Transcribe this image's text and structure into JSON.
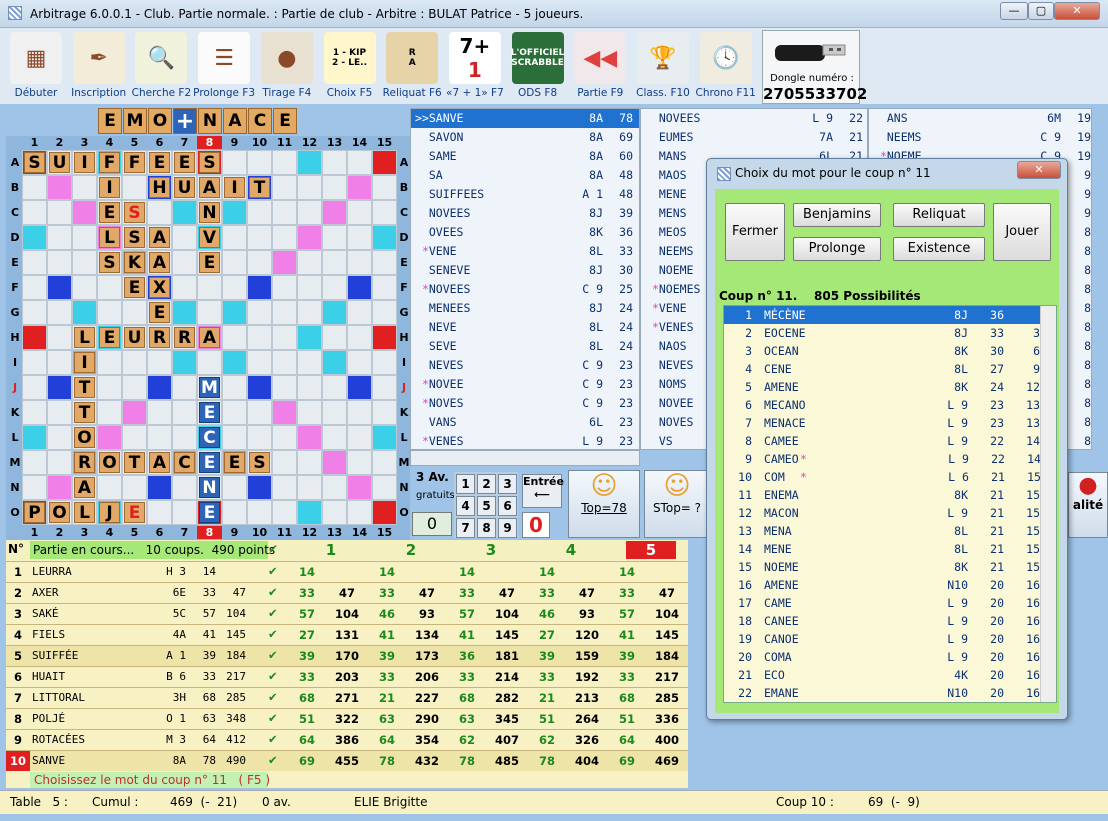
{
  "window": {
    "title": "Arbitrage 6.0.0.1 - Club. Partie normale. : Partie de club - Arbitre : BULAT Patrice - 5 joueurs."
  },
  "toolbar": [
    {
      "label": "Débuter",
      "icon": "grid-icon"
    },
    {
      "label": "Inscription",
      "icon": "quill-icon"
    },
    {
      "label": "Cherche F2",
      "icon": "magnifier-icon"
    },
    {
      "label": "Prolonge F3",
      "icon": "list-icon"
    },
    {
      "label": "Tirage F4",
      "icon": "bag-icon"
    },
    {
      "label": "Choix F5",
      "icon": "choice-icon",
      "text1": "1 - KIP",
      "text2": "2 - LE.."
    },
    {
      "label": "Reliquat F6",
      "icon": "tiles-icon",
      "text1": "R",
      "text2": "A"
    },
    {
      "label": "«7 + 1» F7",
      "icon": "seven-plus-one-icon",
      "text1": "7+",
      "text2": "1"
    },
    {
      "label": "ODS F8",
      "icon": "dictionary-icon",
      "text1": "L'OFFICIEL",
      "text2": "SCRABBLE"
    },
    {
      "label": "Partie F9",
      "icon": "rewind-icon"
    },
    {
      "label": "Class. F10",
      "icon": "trophy-icon"
    },
    {
      "label": "Chrono F11",
      "icon": "clock-icon"
    }
  ],
  "dongle": {
    "label": "Dongle numéro :",
    "number": "2705533702"
  },
  "rack": {
    "left": [
      "E",
      "M",
      "O"
    ],
    "right": [
      "N",
      "A",
      "C",
      "E"
    ],
    "blank": "+"
  },
  "board": {
    "cols": [
      "1",
      "2",
      "3",
      "4",
      "5",
      "6",
      "7",
      "8",
      "9",
      "10",
      "11",
      "12",
      "13",
      "14",
      "15"
    ],
    "rows": [
      "A",
      "B",
      "C",
      "D",
      "E",
      "F",
      "G",
      "H",
      "I",
      "J",
      "K",
      "L",
      "M",
      "N",
      "O"
    ],
    "highlight_col": "8",
    "highlight_row": "J"
  },
  "words_col1": [
    {
      "t": ">>SANVE",
      "p": "8A",
      "s": "78",
      "sel": true
    },
    {
      "t": "  SAVON",
      "p": "8A",
      "s": "69"
    },
    {
      "t": "  SAME",
      "p": "8A",
      "s": "60"
    },
    {
      "t": "  SA",
      "p": "8A",
      "s": "48"
    },
    {
      "t": "  SUIFFEES",
      "p": "A 1",
      "s": "48"
    },
    {
      "t": "  NOVEES",
      "p": "8J",
      "s": "39"
    },
    {
      "t": "  OVEES",
      "p": "8K",
      "s": "36"
    },
    {
      "t": " *VENE",
      "p": "8L",
      "s": "33"
    },
    {
      "t": "  SENEVE",
      "p": "8J",
      "s": "30"
    },
    {
      "t": " *NOVEES",
      "p": "C 9",
      "s": "25"
    },
    {
      "t": "  MENEES",
      "p": "8J",
      "s": "24"
    },
    {
      "t": "  NEVE",
      "p": "8L",
      "s": "24"
    },
    {
      "t": "  SEVE",
      "p": "8L",
      "s": "24"
    },
    {
      "t": "  NEVES",
      "p": "C 9",
      "s": "23"
    },
    {
      "t": " *NOVEE",
      "p": "C 9",
      "s": "23"
    },
    {
      "t": " *NOVES",
      "p": "C 9",
      "s": "23"
    },
    {
      "t": "  VANS",
      "p": "6L",
      "s": "23"
    },
    {
      "t": " *VENES",
      "p": "L 9",
      "s": "23"
    }
  ],
  "words_col2": [
    {
      "t": "  NOVEES",
      "p": "L 9",
      "s": "22"
    },
    {
      "t": "  EUMES",
      "p": "7A",
      "s": "21"
    },
    {
      "t": "  MANS",
      "p": "6L",
      "s": "21"
    },
    {
      "t": "  MAOS",
      "p": "",
      "s": ""
    },
    {
      "t": "  MENE",
      "p": "",
      "s": ""
    },
    {
      "t": "  MENS",
      "p": "",
      "s": ""
    },
    {
      "t": "  MEOS",
      "p": "",
      "s": ""
    },
    {
      "t": "  NEEMS",
      "p": "",
      "s": ""
    },
    {
      "t": "  NOEME",
      "p": "",
      "s": ""
    },
    {
      "t": " *NOEMES",
      "p": "",
      "s": ""
    },
    {
      "t": " *VENE",
      "p": "",
      "s": ""
    },
    {
      "t": " *VENES",
      "p": "",
      "s": ""
    },
    {
      "t": "  NAOS",
      "p": "",
      "s": ""
    },
    {
      "t": "  NEVES",
      "p": "",
      "s": ""
    },
    {
      "t": "  NOMS",
      "p": "",
      "s": ""
    },
    {
      "t": "  NOVEE",
      "p": "",
      "s": ""
    },
    {
      "t": "  NOVES",
      "p": "",
      "s": ""
    },
    {
      "t": "  VS",
      "p": "",
      "s": ""
    }
  ],
  "words_col3": [
    {
      "t": "  ANS",
      "p": "6M",
      "s": "19"
    },
    {
      "t": "  NEEMS",
      "p": "C 9",
      "s": "19"
    },
    {
      "t": " *NOEME",
      "p": "C 9",
      "s": "19"
    },
    {
      "t": "",
      "p": "",
      "s": "9"
    },
    {
      "t": "",
      "p": "",
      "s": "9"
    },
    {
      "t": "",
      "p": "",
      "s": "9"
    },
    {
      "t": "",
      "p": "",
      "s": "8"
    },
    {
      "t": "",
      "p": "",
      "s": "8"
    },
    {
      "t": "",
      "p": "",
      "s": "8"
    },
    {
      "t": "",
      "p": "",
      "s": "8"
    },
    {
      "t": "",
      "p": "",
      "s": "8"
    },
    {
      "t": "",
      "p": "",
      "s": "8"
    },
    {
      "t": "",
      "p": "",
      "s": "8"
    },
    {
      "t": "",
      "p": "",
      "s": "8"
    },
    {
      "t": "",
      "p": "",
      "s": "8"
    },
    {
      "t": "",
      "p": "",
      "s": "8"
    },
    {
      "t": "",
      "p": "",
      "s": "8"
    },
    {
      "t": "",
      "p": "",
      "s": "8"
    }
  ],
  "controls": {
    "av": "3 Av.",
    "gratuits": "gratuits",
    "zero": "0",
    "keys": [
      "1",
      "2",
      "3",
      "4",
      "5",
      "6",
      "7",
      "8",
      "9"
    ],
    "entree": "Entrée",
    "red_zero": "0",
    "top": "Top=78",
    "stop": "STop= ?",
    "qualite": "alité"
  },
  "game": {
    "header": "Partie en cours...   10 coups.  490 points",
    "cols": [
      "1",
      "2",
      "3",
      "4",
      "5"
    ],
    "rows": [
      {
        "n": "1",
        "w": "LEURRA",
        "p": "H 3",
        "s": "14",
        "c": "",
        "v": [
          "14",
          "",
          "14",
          "",
          "14",
          "",
          "14",
          "",
          "14",
          ""
        ]
      },
      {
        "n": "2",
        "w": "AXER",
        "p": "6E",
        "s": "33",
        "c": "47",
        "v": [
          "33",
          "47",
          "33",
          "47",
          "33",
          "47",
          "33",
          "47",
          "33",
          "47"
        ]
      },
      {
        "n": "3",
        "w": "SAKÉ",
        "p": "5C",
        "s": "57",
        "c": "104",
        "v": [
          "57",
          "104",
          "46",
          "93",
          "57",
          "104",
          "46",
          "93",
          "57",
          "104"
        ]
      },
      {
        "n": "4",
        "w": "FIELS",
        "p": "4A",
        "s": "41",
        "c": "145",
        "v": [
          "27",
          "131",
          "41",
          "134",
          "41",
          "145",
          "27",
          "120",
          "41",
          "145"
        ]
      },
      {
        "n": "5",
        "w": "SUIFFÉE",
        "p": "A 1",
        "s": "39",
        "c": "184",
        "v": [
          "39",
          "170",
          "39",
          "173",
          "36",
          "181",
          "39",
          "159",
          "39",
          "184"
        ]
      },
      {
        "n": "6",
        "w": "HUAIT",
        "p": "B 6",
        "s": "33",
        "c": "217",
        "v": [
          "33",
          "203",
          "33",
          "206",
          "33",
          "214",
          "33",
          "192",
          "33",
          "217"
        ]
      },
      {
        "n": "7",
        "w": "LITTORAL",
        "p": "3H",
        "s": "68",
        "c": "285",
        "v": [
          "68",
          "271",
          "21",
          "227",
          "68",
          "282",
          "21",
          "213",
          "68",
          "285"
        ]
      },
      {
        "n": "8",
        "w": "POLJÉ",
        "p": "O 1",
        "s": "63",
        "c": "348",
        "v": [
          "51",
          "322",
          "63",
          "290",
          "63",
          "345",
          "51",
          "264",
          "51",
          "336"
        ]
      },
      {
        "n": "9",
        "w": "ROTACÉES",
        "p": "M 3",
        "s": "64",
        "c": "412",
        "v": [
          "64",
          "386",
          "64",
          "354",
          "62",
          "407",
          "62",
          "326",
          "64",
          "400"
        ]
      },
      {
        "n": "10",
        "w": "SANVE",
        "p": "8A",
        "s": "78",
        "c": "490",
        "v": [
          "69",
          "455",
          "78",
          "432",
          "78",
          "485",
          "78",
          "404",
          "69",
          "469"
        ]
      }
    ],
    "footer": "Choisissez le mot du coup n° 11   ( F5 )"
  },
  "status": {
    "table": "Table   5 :",
    "cumul": "Cumul :",
    "cumul_val": "469  (-  21)",
    "av": "0 av.",
    "player": "ELIE Brigitte",
    "coup": "Coup 10 :",
    "coup_val": "69  (-  9)"
  },
  "dialog": {
    "title": "Choix du mot pour le coup n° 11",
    "buttons": {
      "fermer": "Fermer",
      "benjamins": "Benjamins",
      "reliquat": "Reliquat",
      "prolonge": "Prolonge",
      "existence": "Existence",
      "jouer": "Jouer"
    },
    "info": "Coup n° 11.    805 Possibilités",
    "list": [
      {
        "i": "1",
        "w": "MÉCÈNE",
        "star": false,
        "p": "8J",
        "s": "36",
        "d": ""
      },
      {
        "i": "2",
        "w": "EOCENE",
        "star": false,
        "p": "8J",
        "s": "33",
        "d": "3"
      },
      {
        "i": "3",
        "w": "OCEAN",
        "star": false,
        "p": "8K",
        "s": "30",
        "d": "6"
      },
      {
        "i": "4",
        "w": "CENE",
        "star": false,
        "p": "8L",
        "s": "27",
        "d": "9"
      },
      {
        "i": "5",
        "w": "AMENE",
        "star": false,
        "p": "8K",
        "s": "24",
        "d": "12"
      },
      {
        "i": "6",
        "w": "MECANO",
        "star": false,
        "p": "L 9",
        "s": "23",
        "d": "13"
      },
      {
        "i": "7",
        "w": "MENACE",
        "star": false,
        "p": "L 9",
        "s": "23",
        "d": "13"
      },
      {
        "i": "8",
        "w": "CAMEE",
        "star": false,
        "p": "L 9",
        "s": "22",
        "d": "14"
      },
      {
        "i": "9",
        "w": "CAMEO",
        "star": true,
        "p": "L 9",
        "s": "22",
        "d": "14"
      },
      {
        "i": "10",
        "w": "COM",
        "star": true,
        "p": "L 6",
        "s": "21",
        "d": "15"
      },
      {
        "i": "11",
        "w": "ENEMA",
        "star": false,
        "p": "8K",
        "s": "21",
        "d": "15"
      },
      {
        "i": "12",
        "w": "MACON",
        "star": false,
        "p": "L 9",
        "s": "21",
        "d": "15"
      },
      {
        "i": "13",
        "w": "MENA",
        "star": false,
        "p": "8L",
        "s": "21",
        "d": "15"
      },
      {
        "i": "14",
        "w": "MENE",
        "star": false,
        "p": "8L",
        "s": "21",
        "d": "15"
      },
      {
        "i": "15",
        "w": "NOEME",
        "star": false,
        "p": "8K",
        "s": "21",
        "d": "15"
      },
      {
        "i": "16",
        "w": "AMENE",
        "star": false,
        "p": "N10",
        "s": "20",
        "d": "16"
      },
      {
        "i": "17",
        "w": "CAME",
        "star": false,
        "p": "L 9",
        "s": "20",
        "d": "16"
      },
      {
        "i": "18",
        "w": "CANEE",
        "star": false,
        "p": "L 9",
        "s": "20",
        "d": "16"
      },
      {
        "i": "19",
        "w": "CANOE",
        "star": false,
        "p": "L 9",
        "s": "20",
        "d": "16"
      },
      {
        "i": "20",
        "w": "COMA",
        "star": false,
        "p": "L 9",
        "s": "20",
        "d": "16"
      },
      {
        "i": "21",
        "w": "ECO",
        "star": false,
        "p": "4K",
        "s": "20",
        "d": "16"
      },
      {
        "i": "22",
        "w": "EMANE",
        "star": false,
        "p": "N10",
        "s": "20",
        "d": "16"
      }
    ]
  }
}
